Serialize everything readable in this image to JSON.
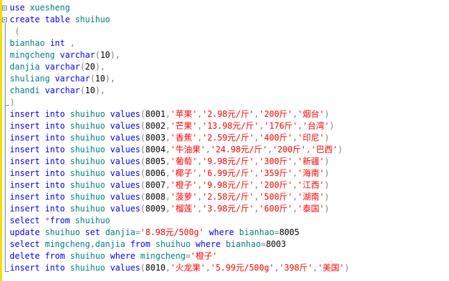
{
  "editor": {
    "lines": [
      [
        {
          "t": "use",
          "c": "kw"
        },
        {
          "t": " ",
          "c": "pl"
        },
        {
          "t": "xuesheng",
          "c": "id"
        }
      ],
      [
        {
          "t": "create",
          "c": "kw"
        },
        {
          "t": " ",
          "c": "pl"
        },
        {
          "t": "table",
          "c": "kw"
        },
        {
          "t": " ",
          "c": "pl"
        },
        {
          "t": "shuihuo",
          "c": "id"
        }
      ],
      [
        {
          "t": " (",
          "c": "op"
        }
      ],
      [
        {
          "t": "bianhao",
          "c": "id"
        },
        {
          "t": " ",
          "c": "pl"
        },
        {
          "t": "int",
          "c": "kw"
        },
        {
          "t": " ,",
          "c": "op"
        }
      ],
      [
        {
          "t": "mingcheng",
          "c": "id"
        },
        {
          "t": " ",
          "c": "pl"
        },
        {
          "t": "varchar",
          "c": "kw"
        },
        {
          "t": "(",
          "c": "op"
        },
        {
          "t": "10",
          "c": "pl"
        },
        {
          "t": "),",
          "c": "op"
        }
      ],
      [
        {
          "t": "danjia",
          "c": "id"
        },
        {
          "t": " ",
          "c": "pl"
        },
        {
          "t": "varchar",
          "c": "kw"
        },
        {
          "t": "(",
          "c": "op"
        },
        {
          "t": "20",
          "c": "pl"
        },
        {
          "t": "),",
          "c": "op"
        }
      ],
      [
        {
          "t": "shuliang",
          "c": "id"
        },
        {
          "t": " ",
          "c": "pl"
        },
        {
          "t": "varchar",
          "c": "kw"
        },
        {
          "t": "(",
          "c": "op"
        },
        {
          "t": "10",
          "c": "pl"
        },
        {
          "t": "),",
          "c": "op"
        }
      ],
      [
        {
          "t": "chandi",
          "c": "id"
        },
        {
          "t": " ",
          "c": "pl"
        },
        {
          "t": "varchar",
          "c": "kw"
        },
        {
          "t": "(",
          "c": "op"
        },
        {
          "t": "10",
          "c": "pl"
        },
        {
          "t": "),",
          "c": "op"
        }
      ],
      [
        {
          "t": ")",
          "c": "op"
        }
      ],
      [
        {
          "t": "insert",
          "c": "kw"
        },
        {
          "t": " ",
          "c": "pl"
        },
        {
          "t": "into",
          "c": "kw"
        },
        {
          "t": " ",
          "c": "pl"
        },
        {
          "t": "shuihuo",
          "c": "id"
        },
        {
          "t": " ",
          "c": "pl"
        },
        {
          "t": "values",
          "c": "kw"
        },
        {
          "t": "(",
          "c": "op"
        },
        {
          "t": "8001",
          "c": "pl"
        },
        {
          "t": ",",
          "c": "op"
        },
        {
          "t": "'苹果'",
          "c": "str"
        },
        {
          "t": ",",
          "c": "op"
        },
        {
          "t": "'2.98元/斤'",
          "c": "str"
        },
        {
          "t": ",",
          "c": "op"
        },
        {
          "t": "'200斤'",
          "c": "str"
        },
        {
          "t": ",",
          "c": "op"
        },
        {
          "t": "'烟台'",
          "c": "str"
        },
        {
          "t": ")",
          "c": "op"
        }
      ],
      [
        {
          "t": "insert",
          "c": "kw"
        },
        {
          "t": " ",
          "c": "pl"
        },
        {
          "t": "into",
          "c": "kw"
        },
        {
          "t": " ",
          "c": "pl"
        },
        {
          "t": "shuihuo",
          "c": "id"
        },
        {
          "t": " ",
          "c": "pl"
        },
        {
          "t": "values",
          "c": "kw"
        },
        {
          "t": "(",
          "c": "op"
        },
        {
          "t": "8002",
          "c": "pl"
        },
        {
          "t": ",",
          "c": "op"
        },
        {
          "t": "'芒果'",
          "c": "str"
        },
        {
          "t": ",",
          "c": "op"
        },
        {
          "t": "'13.98元/斤'",
          "c": "str"
        },
        {
          "t": ",",
          "c": "op"
        },
        {
          "t": "'176斤'",
          "c": "str"
        },
        {
          "t": ",",
          "c": "op"
        },
        {
          "t": "'台湾'",
          "c": "str"
        },
        {
          "t": ")",
          "c": "op"
        }
      ],
      [
        {
          "t": "insert",
          "c": "kw"
        },
        {
          "t": " ",
          "c": "pl"
        },
        {
          "t": "into",
          "c": "kw"
        },
        {
          "t": " ",
          "c": "pl"
        },
        {
          "t": "shuihuo",
          "c": "id"
        },
        {
          "t": " ",
          "c": "pl"
        },
        {
          "t": "values",
          "c": "kw"
        },
        {
          "t": "(",
          "c": "op"
        },
        {
          "t": "8003",
          "c": "pl"
        },
        {
          "t": ",",
          "c": "op"
        },
        {
          "t": "'香蕉'",
          "c": "str"
        },
        {
          "t": ",",
          "c": "op"
        },
        {
          "t": "'2.59元/斤'",
          "c": "str"
        },
        {
          "t": ",",
          "c": "op"
        },
        {
          "t": "'400斤'",
          "c": "str"
        },
        {
          "t": ",",
          "c": "op"
        },
        {
          "t": "'印尼'",
          "c": "str"
        },
        {
          "t": ")",
          "c": "op"
        }
      ],
      [
        {
          "t": "insert",
          "c": "kw"
        },
        {
          "t": " ",
          "c": "pl"
        },
        {
          "t": "into",
          "c": "kw"
        },
        {
          "t": " ",
          "c": "pl"
        },
        {
          "t": "shuihuo",
          "c": "id"
        },
        {
          "t": " ",
          "c": "pl"
        },
        {
          "t": "values",
          "c": "kw"
        },
        {
          "t": "(",
          "c": "op"
        },
        {
          "t": "8004",
          "c": "pl"
        },
        {
          "t": ",",
          "c": "op"
        },
        {
          "t": "'牛油果'",
          "c": "str"
        },
        {
          "t": ",",
          "c": "op"
        },
        {
          "t": "'24.98元/斤'",
          "c": "str"
        },
        {
          "t": ",",
          "c": "op"
        },
        {
          "t": "'200斤'",
          "c": "str"
        },
        {
          "t": ",",
          "c": "op"
        },
        {
          "t": "'巴西'",
          "c": "str"
        },
        {
          "t": ")",
          "c": "op"
        }
      ],
      [
        {
          "t": "insert",
          "c": "kw"
        },
        {
          "t": " ",
          "c": "pl"
        },
        {
          "t": "into",
          "c": "kw"
        },
        {
          "t": " ",
          "c": "pl"
        },
        {
          "t": "shuihuo",
          "c": "id"
        },
        {
          "t": " ",
          "c": "pl"
        },
        {
          "t": "values",
          "c": "kw"
        },
        {
          "t": "(",
          "c": "op"
        },
        {
          "t": "8005",
          "c": "pl"
        },
        {
          "t": ",",
          "c": "op"
        },
        {
          "t": "'葡萄'",
          "c": "str"
        },
        {
          "t": ",",
          "c": "op"
        },
        {
          "t": "'9.98元/斤'",
          "c": "str"
        },
        {
          "t": ",",
          "c": "op"
        },
        {
          "t": "'300斤'",
          "c": "str"
        },
        {
          "t": ",",
          "c": "op"
        },
        {
          "t": "'新疆'",
          "c": "str"
        },
        {
          "t": ")",
          "c": "op"
        }
      ],
      [
        {
          "t": "insert",
          "c": "kw"
        },
        {
          "t": " ",
          "c": "pl"
        },
        {
          "t": "into",
          "c": "kw"
        },
        {
          "t": " ",
          "c": "pl"
        },
        {
          "t": "shuihuo",
          "c": "id"
        },
        {
          "t": " ",
          "c": "pl"
        },
        {
          "t": "values",
          "c": "kw"
        },
        {
          "t": "(",
          "c": "op"
        },
        {
          "t": "8006",
          "c": "pl"
        },
        {
          "t": ",",
          "c": "op"
        },
        {
          "t": "'椰子'",
          "c": "str"
        },
        {
          "t": ",",
          "c": "op"
        },
        {
          "t": "'6.99元/斤'",
          "c": "str"
        },
        {
          "t": ",",
          "c": "op"
        },
        {
          "t": "'359斤'",
          "c": "str"
        },
        {
          "t": ",",
          "c": "op"
        },
        {
          "t": "'海南'",
          "c": "str"
        },
        {
          "t": ")",
          "c": "op"
        }
      ],
      [
        {
          "t": "insert",
          "c": "kw"
        },
        {
          "t": " ",
          "c": "pl"
        },
        {
          "t": "into",
          "c": "kw"
        },
        {
          "t": " ",
          "c": "pl"
        },
        {
          "t": "shuihuo",
          "c": "id"
        },
        {
          "t": " ",
          "c": "pl"
        },
        {
          "t": "values",
          "c": "kw"
        },
        {
          "t": "(",
          "c": "op"
        },
        {
          "t": "8007",
          "c": "pl"
        },
        {
          "t": ",",
          "c": "op"
        },
        {
          "t": "'橙子'",
          "c": "str"
        },
        {
          "t": ",",
          "c": "op"
        },
        {
          "t": "'9.98元/斤'",
          "c": "str"
        },
        {
          "t": ",",
          "c": "op"
        },
        {
          "t": "'200斤'",
          "c": "str"
        },
        {
          "t": ",",
          "c": "op"
        },
        {
          "t": "'江西'",
          "c": "str"
        },
        {
          "t": ")",
          "c": "op"
        }
      ],
      [
        {
          "t": "insert",
          "c": "kw"
        },
        {
          "t": " ",
          "c": "pl"
        },
        {
          "t": "into",
          "c": "kw"
        },
        {
          "t": " ",
          "c": "pl"
        },
        {
          "t": "shuihuo",
          "c": "id"
        },
        {
          "t": " ",
          "c": "pl"
        },
        {
          "t": "values",
          "c": "kw"
        },
        {
          "t": "(",
          "c": "op"
        },
        {
          "t": "8008",
          "c": "pl"
        },
        {
          "t": ",",
          "c": "op"
        },
        {
          "t": "'菠萝'",
          "c": "str"
        },
        {
          "t": ",",
          "c": "op"
        },
        {
          "t": "'2.58元/斤'",
          "c": "str"
        },
        {
          "t": ",",
          "c": "op"
        },
        {
          "t": "'500斤'",
          "c": "str"
        },
        {
          "t": ",",
          "c": "op"
        },
        {
          "t": "'湖南'",
          "c": "str"
        },
        {
          "t": ")",
          "c": "op"
        }
      ],
      [
        {
          "t": "insert",
          "c": "kw"
        },
        {
          "t": " ",
          "c": "pl"
        },
        {
          "t": "into",
          "c": "kw"
        },
        {
          "t": " ",
          "c": "pl"
        },
        {
          "t": "shuihuo",
          "c": "id"
        },
        {
          "t": " ",
          "c": "pl"
        },
        {
          "t": "values",
          "c": "kw"
        },
        {
          "t": "(",
          "c": "op"
        },
        {
          "t": "8009",
          "c": "pl"
        },
        {
          "t": ",",
          "c": "op"
        },
        {
          "t": "'榴莲'",
          "c": "str"
        },
        {
          "t": ",",
          "c": "op"
        },
        {
          "t": "'3.98元/斤'",
          "c": "str"
        },
        {
          "t": ",",
          "c": "op"
        },
        {
          "t": "'600斤'",
          "c": "str"
        },
        {
          "t": ",",
          "c": "op"
        },
        {
          "t": "'泰国'",
          "c": "str"
        },
        {
          "t": ")",
          "c": "op"
        }
      ],
      [
        {
          "t": "select",
          "c": "kw"
        },
        {
          "t": " *",
          "c": "op"
        },
        {
          "t": "from",
          "c": "kw"
        },
        {
          "t": " ",
          "c": "pl"
        },
        {
          "t": "shuihuo",
          "c": "id"
        }
      ],
      [
        {
          "t": "update",
          "c": "kw"
        },
        {
          "t": " ",
          "c": "pl"
        },
        {
          "t": "shuihuo",
          "c": "id"
        },
        {
          "t": " ",
          "c": "pl"
        },
        {
          "t": "set",
          "c": "kw"
        },
        {
          "t": " ",
          "c": "pl"
        },
        {
          "t": "danjia",
          "c": "id"
        },
        {
          "t": "=",
          "c": "op"
        },
        {
          "t": "'8.98元/500g'",
          "c": "str"
        },
        {
          "t": " ",
          "c": "pl"
        },
        {
          "t": "where",
          "c": "kw"
        },
        {
          "t": " ",
          "c": "pl"
        },
        {
          "t": "bianhao",
          "c": "id"
        },
        {
          "t": "=",
          "c": "op"
        },
        {
          "t": "8005",
          "c": "pl"
        }
      ],
      [
        {
          "t": "select",
          "c": "kw"
        },
        {
          "t": " ",
          "c": "pl"
        },
        {
          "t": "mingcheng",
          "c": "id"
        },
        {
          "t": ",",
          "c": "op"
        },
        {
          "t": "danjia",
          "c": "id"
        },
        {
          "t": " ",
          "c": "pl"
        },
        {
          "t": "from",
          "c": "kw"
        },
        {
          "t": " ",
          "c": "pl"
        },
        {
          "t": "shuihuo",
          "c": "id"
        },
        {
          "t": " ",
          "c": "pl"
        },
        {
          "t": "where",
          "c": "kw"
        },
        {
          "t": " ",
          "c": "pl"
        },
        {
          "t": "bianhao",
          "c": "id"
        },
        {
          "t": "=",
          "c": "op"
        },
        {
          "t": "8003",
          "c": "pl"
        }
      ],
      [
        {
          "t": "delete",
          "c": "kw"
        },
        {
          "t": " ",
          "c": "pl"
        },
        {
          "t": "from",
          "c": "kw"
        },
        {
          "t": " ",
          "c": "pl"
        },
        {
          "t": "shuihuo",
          "c": "id"
        },
        {
          "t": " ",
          "c": "pl"
        },
        {
          "t": "where",
          "c": "kw"
        },
        {
          "t": " ",
          "c": "pl"
        },
        {
          "t": "mingcheng",
          "c": "id"
        },
        {
          "t": "=",
          "c": "op"
        },
        {
          "t": "'橙子'",
          "c": "str"
        }
      ],
      [
        {
          "t": "insert",
          "c": "kw"
        },
        {
          "t": " ",
          "c": "pl"
        },
        {
          "t": "into",
          "c": "kw"
        },
        {
          "t": " ",
          "c": "pl"
        },
        {
          "t": "shuihuo",
          "c": "id"
        },
        {
          "t": " ",
          "c": "pl"
        },
        {
          "t": "values",
          "c": "kw"
        },
        {
          "t": "(",
          "c": "op"
        },
        {
          "t": "8010",
          "c": "pl"
        },
        {
          "t": ",",
          "c": "op"
        },
        {
          "t": "'火龙果'",
          "c": "str"
        },
        {
          "t": ",",
          "c": "op"
        },
        {
          "t": "'5.99元/500g'",
          "c": "str"
        },
        {
          "t": ",",
          "c": "op"
        },
        {
          "t": "'398斤'",
          "c": "str"
        },
        {
          "t": ",",
          "c": "op"
        },
        {
          "t": "'美国'",
          "c": "str"
        },
        {
          "t": ")",
          "c": "op"
        }
      ]
    ]
  },
  "colors": {
    "keyword": "#0000ff",
    "identifier": "#008080",
    "operator": "#808080",
    "string": "#ff0000",
    "change_bar": "#f0e000"
  }
}
